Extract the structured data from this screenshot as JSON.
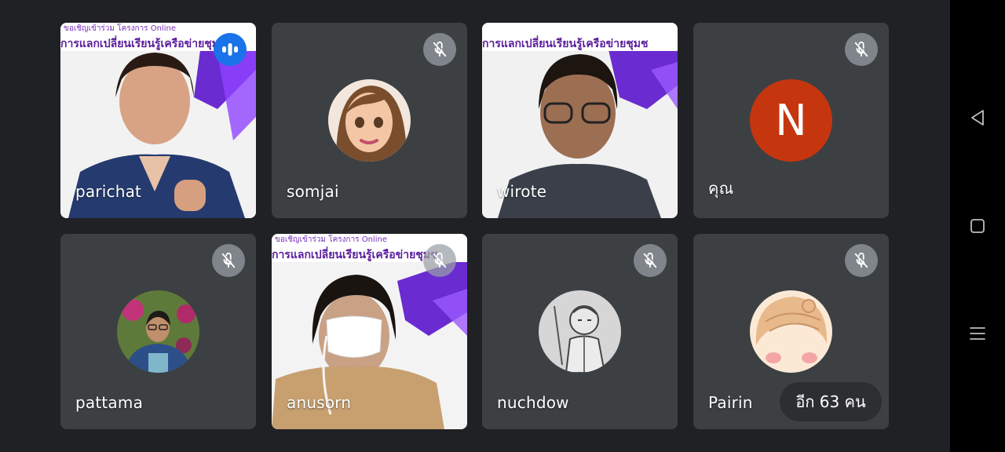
{
  "participants": [
    {
      "name": "parichat",
      "state": "speaking"
    },
    {
      "name": "somjai",
      "state": "muted"
    },
    {
      "name": "wirote",
      "state": "video"
    },
    {
      "name": "คุณ",
      "state": "muted",
      "avatar_letter": "N"
    },
    {
      "name": "pattama",
      "state": "muted"
    },
    {
      "name": "anusorn",
      "state": "muted"
    },
    {
      "name": "nuchdow",
      "state": "muted"
    },
    {
      "name": "Pairin",
      "state": "muted"
    }
  ],
  "banner": {
    "line1": "ขอเชิญเข้าร่วม โครงการ Online",
    "line2": "การแลกเปลี่ยนเรียนรู้เครือข่ายชุมช"
  },
  "more_participants": "อีก 63 คน",
  "colors": {
    "background": "#202124",
    "tile": "#3c4043",
    "speaking": "#1a73e8",
    "avatar_n": "#c5360f",
    "navbar": "#000000"
  },
  "icons": {
    "mute": "mic-off-icon",
    "speaking": "audio-level-icon",
    "nav_back": "back-triangle-icon",
    "nav_home": "home-square-icon",
    "nav_menu": "menu-lines-icon"
  }
}
